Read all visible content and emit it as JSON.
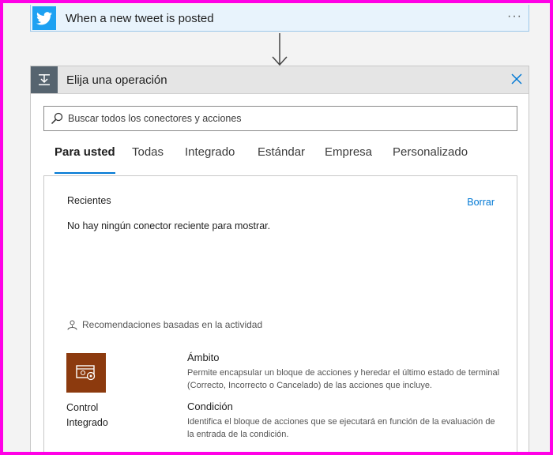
{
  "trigger": {
    "title": "When a new tweet is posted",
    "more": "···",
    "icon": "twitter-icon",
    "color": "#1da1f2"
  },
  "panel": {
    "title": "Elija una operación",
    "icon": "operation-icon",
    "close_icon": "close-icon"
  },
  "search": {
    "placeholder": "Buscar todos los conectores y acciones"
  },
  "tabs": [
    {
      "label": "Para usted",
      "active": true
    },
    {
      "label": "Todas"
    },
    {
      "label": "Integrado"
    },
    {
      "label": "Estándar"
    },
    {
      "label": "Empresa"
    },
    {
      "label": "Personalizado"
    }
  ],
  "recent": {
    "heading": "Recientes",
    "clear": "Borrar",
    "empty_message": "No hay ningún conector reciente para mostrar."
  },
  "recommendations": {
    "heading": "Recomendaciones basadas en la actividad"
  },
  "connector": {
    "name_line1": "Control",
    "name_line2": "Integrado",
    "color": "#8c3a0e"
  },
  "actions": [
    {
      "name": "Ámbito",
      "description": "Permite encapsular un bloque de acciones y heredar el último estado de terminal (Correcto, Incorrecto o Cancelado) de las acciones que incluye."
    },
    {
      "name": "Condición",
      "description": "Identifica el bloque de acciones que se ejecutará en función de la evaluación de la entrada de la condición."
    }
  ],
  "accent": "#0078d4"
}
